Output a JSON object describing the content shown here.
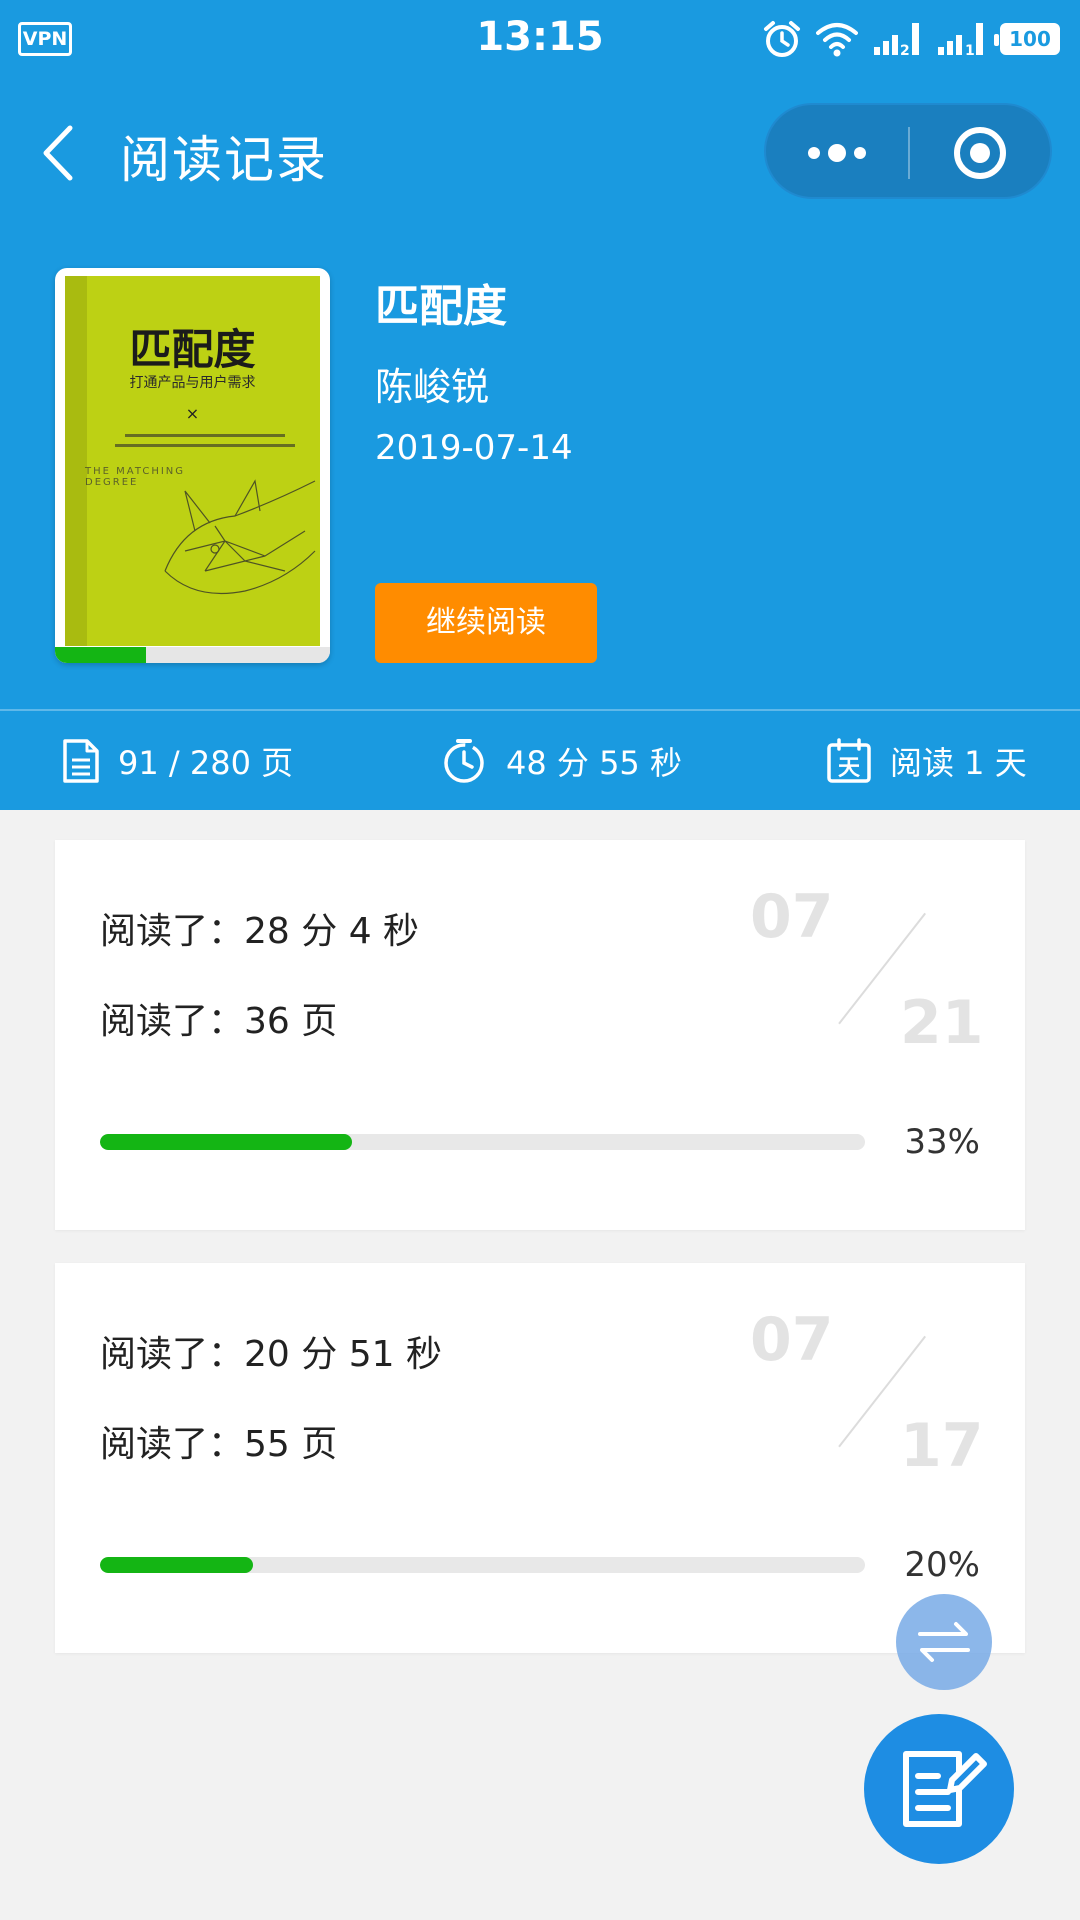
{
  "status_bar": {
    "vpn_label": "VPN",
    "time": "13:15",
    "sim1": "2",
    "sim2": "1",
    "battery": "100"
  },
  "nav": {
    "title": "阅读记录",
    "back_icon": "chevron-left-icon",
    "more_icon": "more-dots-icon",
    "close_icon": "target-circle-icon"
  },
  "book": {
    "title": "匹配度",
    "author": "陈峻锐",
    "date": "2019-07-14",
    "continue_label": "继续阅读",
    "cover": {
      "title": "匹配度",
      "subtitle": "打通产品与用户需求",
      "mark": "×"
    },
    "progress_fraction": 0.33
  },
  "stats": {
    "pages": "91 / 280 页",
    "duration": "48 分 55 秒",
    "days": "阅读 1 天"
  },
  "records": [
    {
      "time_line": "阅读了：28 分 4 秒",
      "pages_line": "阅读了：36 页",
      "month": "07",
      "day": "21",
      "percent_label": "33%",
      "percent": 0.33
    },
    {
      "time_line": "阅读了：20 分 51 秒",
      "pages_line": "阅读了：55 页",
      "month": "07",
      "day": "17",
      "percent_label": "20%",
      "percent": 0.2
    }
  ],
  "fab": {
    "swap_icon": "swap-arrows-icon",
    "note_icon": "edit-note-icon"
  },
  "colors": {
    "primary": "#1a9ae0",
    "accent": "#ff8c00",
    "progress": "#14b514",
    "fab": "#1e8de3"
  }
}
